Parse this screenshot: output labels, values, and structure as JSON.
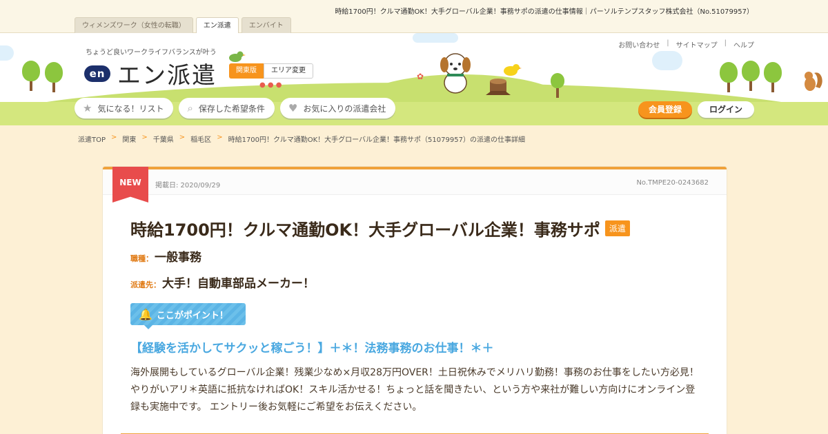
{
  "page_heading": "時給1700円！クルマ通勤OK！大手グローバル企業！事務サポの派遣の仕事情報｜パーソルテンプスタッフ株式会社（No.51079957）",
  "site_tabs": [
    {
      "label": "ウィメンズワーク（女性の転職）",
      "active": false
    },
    {
      "label": "エン派遣",
      "active": true
    },
    {
      "label": "エンバイト",
      "active": false
    }
  ],
  "header": {
    "tagline": "ちょうど良いワークライフバランスが叶う",
    "logo_mark": "en",
    "logo_text": "エン派遣",
    "region": "関東版",
    "region_change": "エリア変更",
    "utility_links": [
      "お問い合わせ",
      "サイトマップ",
      "ヘルプ"
    ],
    "subnav": [
      {
        "label": "気になる！リスト",
        "icon": "star-icon",
        "glyph": "★"
      },
      {
        "label": "保存した希望条件",
        "icon": "search-icon",
        "glyph": "⌕"
      },
      {
        "label": "お気に入りの派遣会社",
        "icon": "heart-icon",
        "glyph": "♥"
      }
    ],
    "register": "会員登録",
    "login": "ログイン"
  },
  "breadcrumb": [
    "派遣TOP",
    "関東",
    "千葉県",
    "稲毛区",
    "時給1700円！クルマ通勤OK！大手グローバル企業！事務サポ（51079957）の派遣の仕事詳細"
  ],
  "breadcrumb_sep": ">",
  "job": {
    "new_label": "NEW",
    "posted": "掲載日: 2020/09/29",
    "job_no": "No.TMPE20-0243682",
    "title": "時給1700円！クルマ通勤OK！大手グローバル企業！事務サポ",
    "type_badge": "派遣",
    "occupation_label": "職種：",
    "occupation": "一般事務",
    "client_label": "派遣先：",
    "client": "大手！自動車部品メーカー！",
    "point_label": "ここがポイント！",
    "catchphrase": "【経験を活かしてサクッと稼ごう！】＋＊！法務事務のお仕事！＊＋",
    "description": "海外展開もしているグローバル企業！残業少なめ×月収28万円OVER！土日祝休みでメリハリ勤務！事務のお仕事をしたい方必見！やりがいアリ＊英語に抵抗なければOK！スキル活かせる！ちょっと話を聞きたい、という方や来社が難しい方向けにオンライン登録も実施中です。 エントリー後お気軽にご希望をお伝えください。"
  },
  "colors": {
    "accent": "#f7941d",
    "point_blue": "#5bb4e5",
    "grass": "#c8e06f",
    "background": "#fdf0d5",
    "new_red": "#e84c4c"
  }
}
